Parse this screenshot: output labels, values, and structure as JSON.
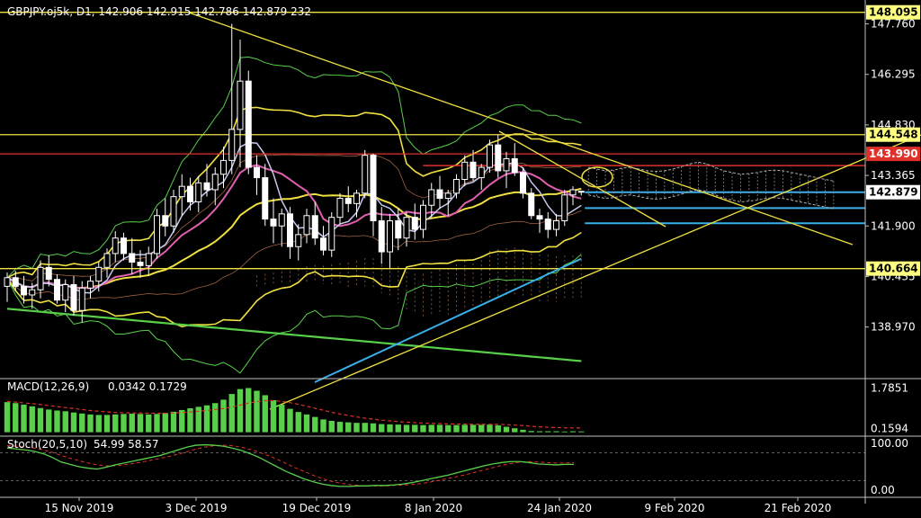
{
  "header": {
    "symbol_line": "GBPJPY.oj5k, D1, 142.906 142.915 142.786 142.879 232"
  },
  "colors": {
    "background": "#000000",
    "bull": "#ffffff",
    "bear": "#ffffff",
    "yellow": "#f0e040",
    "red": "#e0302a",
    "blue": "#3aaee8",
    "green": "#58d04a",
    "pink": "#e060b0",
    "lavender": "#c8c8f0",
    "axis": "#c0c0c0"
  },
  "chart_data": [
    {
      "type": "candlestick",
      "title": "GBPJPY.oj5k, D1",
      "ohlc_last": {
        "open": 142.906,
        "high": 142.915,
        "low": 142.786,
        "close": 142.879,
        "volume": 232
      },
      "ylim": [
        137.5,
        148.4
      ],
      "y_ticks": [
        "147.760",
        "146.295",
        "144.830",
        "143.365",
        "141.900",
        "140.435",
        "138.970"
      ],
      "price_tags": [
        {
          "value": "148.095",
          "style": "yellow"
        },
        {
          "value": "144.548",
          "style": "yellow"
        },
        {
          "value": "143.990",
          "style": "red"
        },
        {
          "value": "142.879",
          "style": "white"
        },
        {
          "value": "140.664",
          "style": "yellow"
        }
      ],
      "x_labels": [
        "15 Nov 2019",
        "3 Dec 2019",
        "19 Dec 2019",
        "8 Jan 2020",
        "24 Jan 2020",
        "9 Feb 2020",
        "21 Feb 2020"
      ],
      "candles": [
        [
          140.15,
          140.55,
          139.7,
          140.4
        ],
        [
          140.4,
          140.6,
          140.0,
          140.15
        ],
        [
          140.15,
          140.45,
          139.65,
          139.9
        ],
        [
          139.9,
          140.25,
          139.5,
          140.05
        ],
        [
          140.05,
          140.9,
          139.8,
          140.7
        ],
        [
          140.7,
          141.05,
          140.15,
          140.35
        ],
        [
          140.35,
          140.5,
          139.65,
          139.75
        ],
        [
          139.75,
          140.35,
          139.4,
          140.2
        ],
        [
          140.2,
          140.45,
          139.3,
          139.45
        ],
        [
          139.45,
          140.3,
          139.1,
          140.1
        ],
        [
          140.1,
          140.45,
          139.8,
          140.3
        ],
        [
          140.3,
          140.85,
          140.0,
          140.7
        ],
        [
          140.7,
          141.25,
          140.4,
          141.1
        ],
        [
          141.1,
          141.75,
          140.85,
          141.55
        ],
        [
          141.55,
          141.7,
          140.9,
          141.1
        ],
        [
          141.1,
          141.55,
          140.5,
          140.85
        ],
        [
          140.85,
          141.2,
          140.4,
          140.75
        ],
        [
          140.75,
          141.3,
          140.45,
          141.1
        ],
        [
          141.1,
          142.4,
          140.95,
          142.2
        ],
        [
          142.2,
          142.7,
          141.6,
          141.9
        ],
        [
          141.9,
          142.95,
          141.7,
          142.75
        ],
        [
          142.75,
          143.4,
          142.2,
          143.05
        ],
        [
          143.05,
          143.3,
          142.35,
          142.6
        ],
        [
          142.6,
          143.35,
          142.3,
          143.15
        ],
        [
          143.15,
          143.7,
          142.75,
          142.95
        ],
        [
          142.95,
          143.6,
          142.5,
          143.4
        ],
        [
          143.4,
          144.2,
          143.0,
          143.8
        ],
        [
          143.8,
          147.76,
          143.4,
          144.7
        ],
        [
          144.7,
          147.3,
          143.6,
          146.1
        ],
        [
          146.1,
          146.4,
          143.4,
          143.6
        ],
        [
          143.6,
          143.95,
          142.8,
          143.3
        ],
        [
          143.3,
          143.7,
          141.9,
          142.1
        ],
        [
          142.1,
          142.7,
          141.4,
          141.9
        ],
        [
          141.9,
          142.4,
          141.3,
          142.25
        ],
        [
          142.25,
          142.45,
          140.95,
          141.3
        ],
        [
          141.3,
          141.95,
          140.9,
          141.65
        ],
        [
          141.65,
          142.4,
          141.4,
          142.2
        ],
        [
          142.2,
          142.6,
          141.35,
          141.55
        ],
        [
          141.55,
          141.9,
          141.05,
          141.2
        ],
        [
          141.2,
          142.3,
          141.0,
          142.15
        ],
        [
          142.15,
          142.85,
          141.95,
          142.7
        ],
        [
          142.7,
          143.05,
          142.3,
          142.55
        ],
        [
          142.55,
          142.95,
          142.15,
          142.85
        ],
        [
          142.85,
          144.1,
          142.7,
          143.95
        ],
        [
          143.95,
          144.0,
          141.6,
          142.05
        ],
        [
          142.05,
          142.45,
          140.8,
          141.15
        ],
        [
          141.15,
          142.25,
          140.65,
          142.05
        ],
        [
          142.05,
          142.4,
          141.2,
          141.55
        ],
        [
          141.55,
          142.3,
          141.3,
          142.15
        ],
        [
          142.15,
          142.55,
          141.5,
          141.8
        ],
        [
          141.8,
          142.65,
          141.55,
          142.5
        ],
        [
          142.5,
          143.15,
          142.15,
          142.95
        ],
        [
          142.95,
          143.35,
          142.4,
          142.7
        ],
        [
          142.7,
          142.95,
          142.2,
          142.85
        ],
        [
          142.85,
          143.4,
          142.7,
          143.25
        ],
        [
          143.25,
          143.95,
          143.05,
          143.75
        ],
        [
          143.75,
          144.1,
          143.2,
          143.3
        ],
        [
          143.3,
          143.7,
          142.95,
          143.6
        ],
        [
          143.6,
          144.4,
          143.45,
          144.25
        ],
        [
          144.25,
          144.55,
          143.3,
          143.5
        ],
        [
          143.5,
          144.05,
          143.0,
          143.85
        ],
        [
          143.85,
          144.3,
          143.35,
          143.45
        ],
        [
          143.45,
          143.6,
          142.7,
          142.85
        ],
        [
          142.85,
          143.0,
          142.1,
          142.2
        ],
        [
          142.2,
          142.4,
          141.7,
          142.1
        ],
        [
          142.1,
          142.3,
          141.55,
          141.8
        ],
        [
          141.8,
          142.25,
          141.6,
          142.05
        ],
        [
          142.05,
          142.95,
          141.9,
          142.8
        ],
        [
          142.8,
          143.05,
          142.5,
          142.95
        ],
        [
          142.906,
          142.915,
          142.786,
          142.879
        ]
      ],
      "horizontal_lines": [
        {
          "value": 148.095,
          "color": "yellow"
        },
        {
          "value": 144.548,
          "color": "yellow"
        },
        {
          "value": 143.99,
          "color": "red"
        },
        {
          "value": 140.664,
          "color": "yellow"
        }
      ]
    },
    {
      "type": "bar",
      "title": "MACD(12,26,9)",
      "values_text": "0.0342 0.1729",
      "y_ticks": [
        "1.7851",
        "0.1594"
      ],
      "ylim": [
        -0.05,
        2.1
      ],
      "macd": [
        1.22,
        1.18,
        1.12,
        1.05,
        0.98,
        0.92,
        0.88,
        0.85,
        0.8,
        0.76,
        0.72,
        0.7,
        0.7,
        0.72,
        0.74,
        0.75,
        0.74,
        0.72,
        0.74,
        0.78,
        0.83,
        0.9,
        0.97,
        1.03,
        1.09,
        1.18,
        1.32,
        1.55,
        1.75,
        1.79,
        1.68,
        1.5,
        1.3,
        1.12,
        0.95,
        0.82,
        0.72,
        0.62,
        0.52,
        0.46,
        0.42,
        0.4,
        0.38,
        0.38,
        0.36,
        0.33,
        0.32,
        0.31,
        0.3,
        0.3,
        0.29,
        0.3,
        0.3,
        0.29,
        0.29,
        0.3,
        0.3,
        0.3,
        0.31,
        0.28,
        0.22,
        0.16,
        0.1,
        0.05,
        0.04,
        0.04,
        0.04,
        0.03,
        0.04,
        0.0342
      ],
      "signal": [
        1.25,
        1.22,
        1.19,
        1.16,
        1.12,
        1.08,
        1.04,
        1.0,
        0.96,
        0.92,
        0.88,
        0.85,
        0.82,
        0.8,
        0.79,
        0.78,
        0.78,
        0.77,
        0.77,
        0.77,
        0.78,
        0.8,
        0.82,
        0.85,
        0.88,
        0.92,
        0.96,
        1.02,
        1.1,
        1.18,
        1.24,
        1.28,
        1.28,
        1.25,
        1.2,
        1.13,
        1.05,
        0.97,
        0.89,
        0.81,
        0.74,
        0.68,
        0.62,
        0.57,
        0.53,
        0.49,
        0.46,
        0.43,
        0.41,
        0.39,
        0.37,
        0.36,
        0.35,
        0.34,
        0.33,
        0.33,
        0.32,
        0.32,
        0.32,
        0.32,
        0.31,
        0.29,
        0.27,
        0.24,
        0.22,
        0.2,
        0.19,
        0.18,
        0.175,
        0.1729
      ]
    },
    {
      "type": "line",
      "title": "Stoch(20,5,10)",
      "values_text": "54.99 58.57",
      "y_ticks": [
        "100.00",
        "0.00"
      ],
      "ylim": [
        0,
        100
      ],
      "k": [
        90,
        88,
        86,
        83,
        78,
        70,
        60,
        55,
        50,
        47,
        45,
        49,
        54,
        58,
        62,
        66,
        70,
        74,
        80,
        86,
        92,
        96,
        97,
        96,
        94,
        90,
        85,
        78,
        70,
        60,
        50,
        40,
        32,
        24,
        18,
        13,
        10,
        8,
        8,
        9,
        9,
        10,
        10,
        11,
        13,
        16,
        20,
        24,
        28,
        32,
        37,
        42,
        47,
        52,
        56,
        59,
        61,
        61,
        59,
        56,
        55,
        54,
        55,
        54.99
      ],
      "d": [
        95,
        94,
        92,
        90,
        86,
        81,
        74,
        68,
        63,
        58,
        54,
        52,
        52,
        54,
        57,
        60,
        64,
        68,
        72,
        77,
        82,
        88,
        92,
        95,
        96,
        95,
        92,
        87,
        81,
        74,
        66,
        57,
        48,
        40,
        32,
        25,
        19,
        15,
        12,
        10,
        9,
        9,
        9,
        10,
        11,
        12,
        14,
        17,
        21,
        25,
        29,
        33,
        38,
        43,
        48,
        53,
        57,
        60,
        61,
        60,
        59,
        58,
        58,
        58.57
      ]
    }
  ]
}
